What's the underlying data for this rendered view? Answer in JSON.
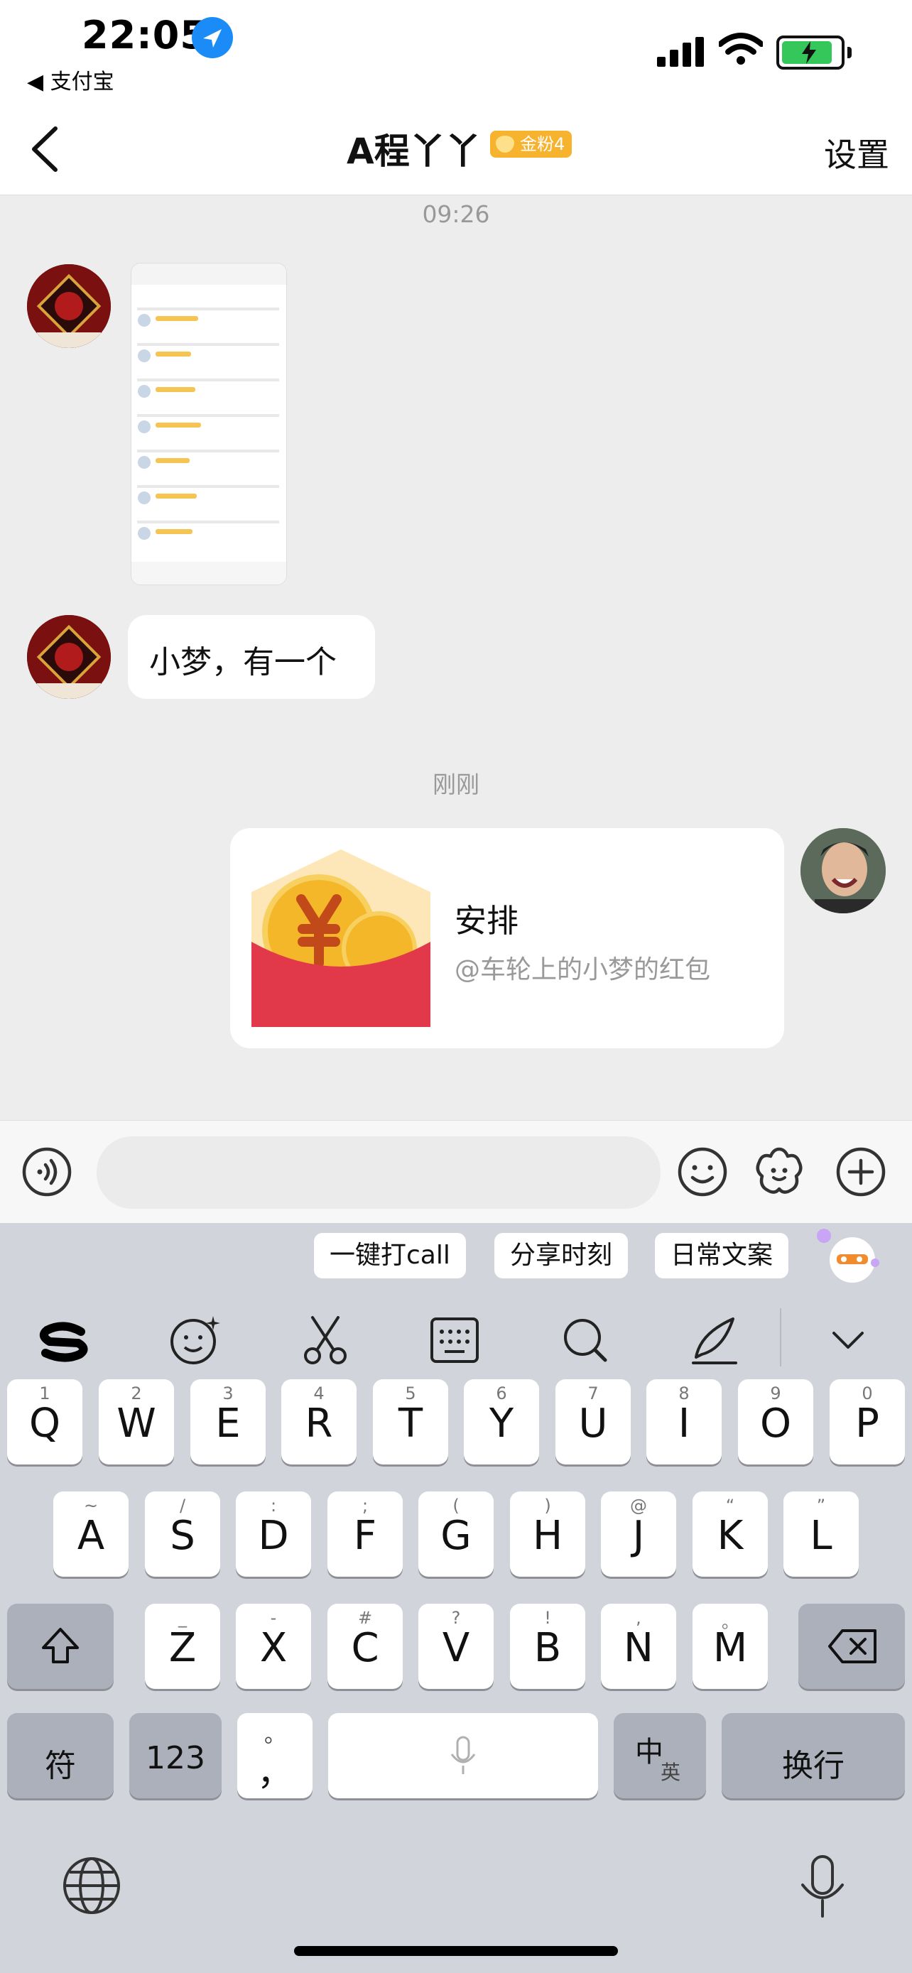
{
  "status_bar": {
    "time": "22:05",
    "back_app": "◀ 支付宝"
  },
  "nav": {
    "title": "A程丫丫",
    "fan_badge": "金粉4",
    "settings": "设置"
  },
  "chat": {
    "timestamp1": "09:26",
    "text_message": "小梦，有一个",
    "timestamp2": "刚刚",
    "red_packet": {
      "title": "安排",
      "subtitle": "@车轮上的小梦的红包"
    }
  },
  "input_bar": {
    "placeholder": ""
  },
  "keyboard": {
    "suggestions": [
      "一键打call",
      "分享时刻",
      "日常文案"
    ],
    "row1": [
      {
        "letter": "Q",
        "sub": "1"
      },
      {
        "letter": "W",
        "sub": "2"
      },
      {
        "letter": "E",
        "sub": "3"
      },
      {
        "letter": "R",
        "sub": "4"
      },
      {
        "letter": "T",
        "sub": "5"
      },
      {
        "letter": "Y",
        "sub": "6"
      },
      {
        "letter": "U",
        "sub": "7"
      },
      {
        "letter": "I",
        "sub": "8"
      },
      {
        "letter": "O",
        "sub": "9"
      },
      {
        "letter": "P",
        "sub": "0"
      }
    ],
    "row2": [
      {
        "letter": "A",
        "sub": "~"
      },
      {
        "letter": "S",
        "sub": "/"
      },
      {
        "letter": "D",
        "sub": ":"
      },
      {
        "letter": "F",
        "sub": ";"
      },
      {
        "letter": "G",
        "sub": "("
      },
      {
        "letter": "H",
        "sub": ")"
      },
      {
        "letter": "J",
        "sub": "@"
      },
      {
        "letter": "K",
        "sub": "“"
      },
      {
        "letter": "L",
        "sub": "”"
      }
    ],
    "row3": [
      {
        "letter": "Z",
        "sub": "_"
      },
      {
        "letter": "X",
        "sub": "-"
      },
      {
        "letter": "C",
        "sub": "#"
      },
      {
        "letter": "V",
        "sub": "?"
      },
      {
        "letter": "B",
        "sub": "!"
      },
      {
        "letter": "N",
        "sub": ","
      },
      {
        "letter": "M",
        "sub": "。"
      }
    ],
    "symbols_key": "符",
    "numbers_key": "123",
    "punct_key_main": "，",
    "punct_key_sub": "。",
    "lang_key_main": "中",
    "lang_key_sub": "英",
    "return_key": "换行"
  },
  "colors": {
    "red_packet": "#e2394a",
    "coin": "#f5b72a",
    "badge": "#f7b22e",
    "location": "#1b8cf7",
    "battery": "#35c759"
  }
}
